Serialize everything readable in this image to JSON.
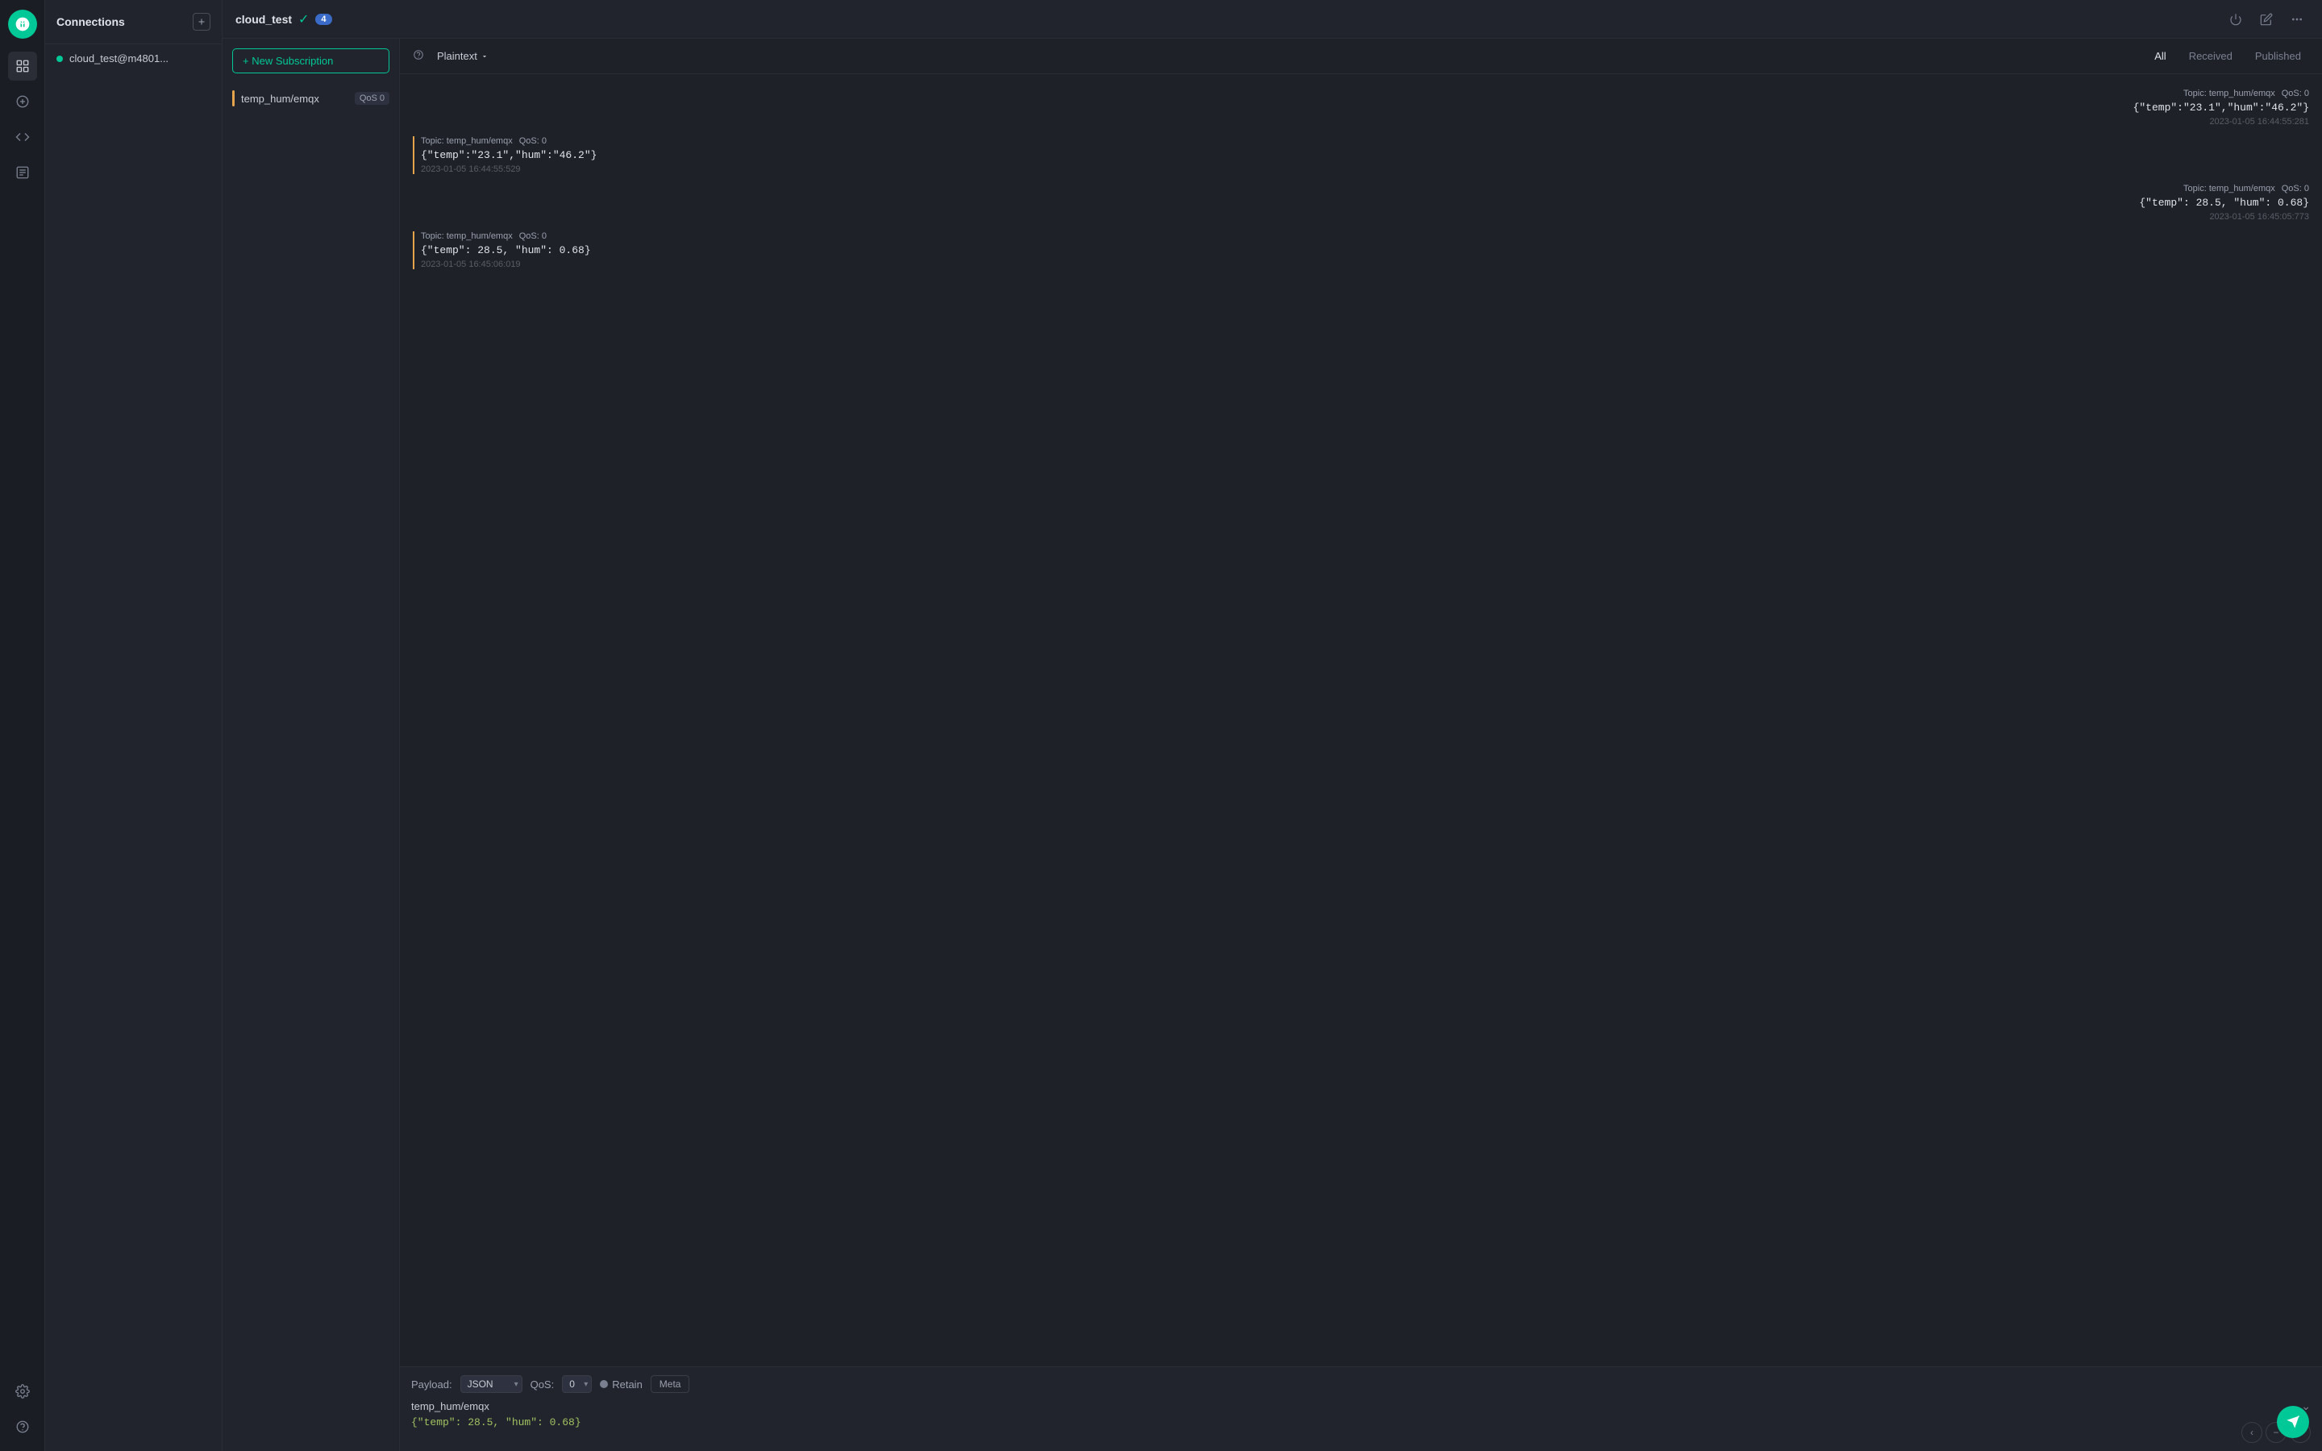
{
  "app": {
    "logo_alt": "MQTTX Logo"
  },
  "sidebar": {
    "title": "Connections",
    "add_tooltip": "Add Connection",
    "connections": [
      {
        "name": "cloud_test@m4801...",
        "status": "connected"
      }
    ]
  },
  "topbar": {
    "title": "cloud_test",
    "badge_count": "4",
    "power_icon": "⏻",
    "edit_icon": "✎",
    "more_icon": "⋯"
  },
  "subscriptions": {
    "new_sub_label": "+ New Subscription",
    "items": [
      {
        "topic": "temp_hum/emqx",
        "qos_label": "QoS 0",
        "color": "#e5a44b"
      }
    ]
  },
  "message_toolbar": {
    "format_label": "Plaintext",
    "filter_all": "All",
    "filter_received": "Received",
    "filter_published": "Published"
  },
  "messages": [
    {
      "type": "published",
      "topic": "Topic: temp_hum/emqx",
      "qos": "QoS: 0",
      "content": "{\"temp\":\"23.1\",\"hum\":\"46.2\"}",
      "timestamp": "2023-01-05 16:44:55:281"
    },
    {
      "type": "received",
      "topic": "Topic: temp_hum/emqx",
      "qos": "QoS: 0",
      "content": "{\"temp\":\"23.1\",\"hum\":\"46.2\"}",
      "timestamp": "2023-01-05 16:44:55:529"
    },
    {
      "type": "published",
      "topic": "Topic: temp_hum/emqx",
      "qos": "QoS: 0",
      "content": "{\"temp\": 28.5, \"hum\": 0.68}",
      "timestamp": "2023-01-05 16:45:05:773"
    },
    {
      "type": "received",
      "topic": "Topic: temp_hum/emqx",
      "qos": "QoS: 0",
      "content": "{\"temp\": 28.5, \"hum\": 0.68}",
      "timestamp": "2023-01-05 16:45:06:019"
    }
  ],
  "publish": {
    "payload_label": "Payload:",
    "payload_format": "JSON",
    "qos_label": "QoS:",
    "qos_value": "0",
    "retain_label": "Retain",
    "meta_label": "Meta",
    "topic": "temp_hum/emqx",
    "payload": "{\"temp\": 28.5, \"hum\": 0.68}",
    "send_icon": "➤"
  },
  "icons": {
    "sidebar_add": "⊞",
    "new_sub_plus": "+",
    "chevron_down": "⌄",
    "check": "✓",
    "left_nav": "‹",
    "minus_nav": "−",
    "right_nav": "›"
  }
}
